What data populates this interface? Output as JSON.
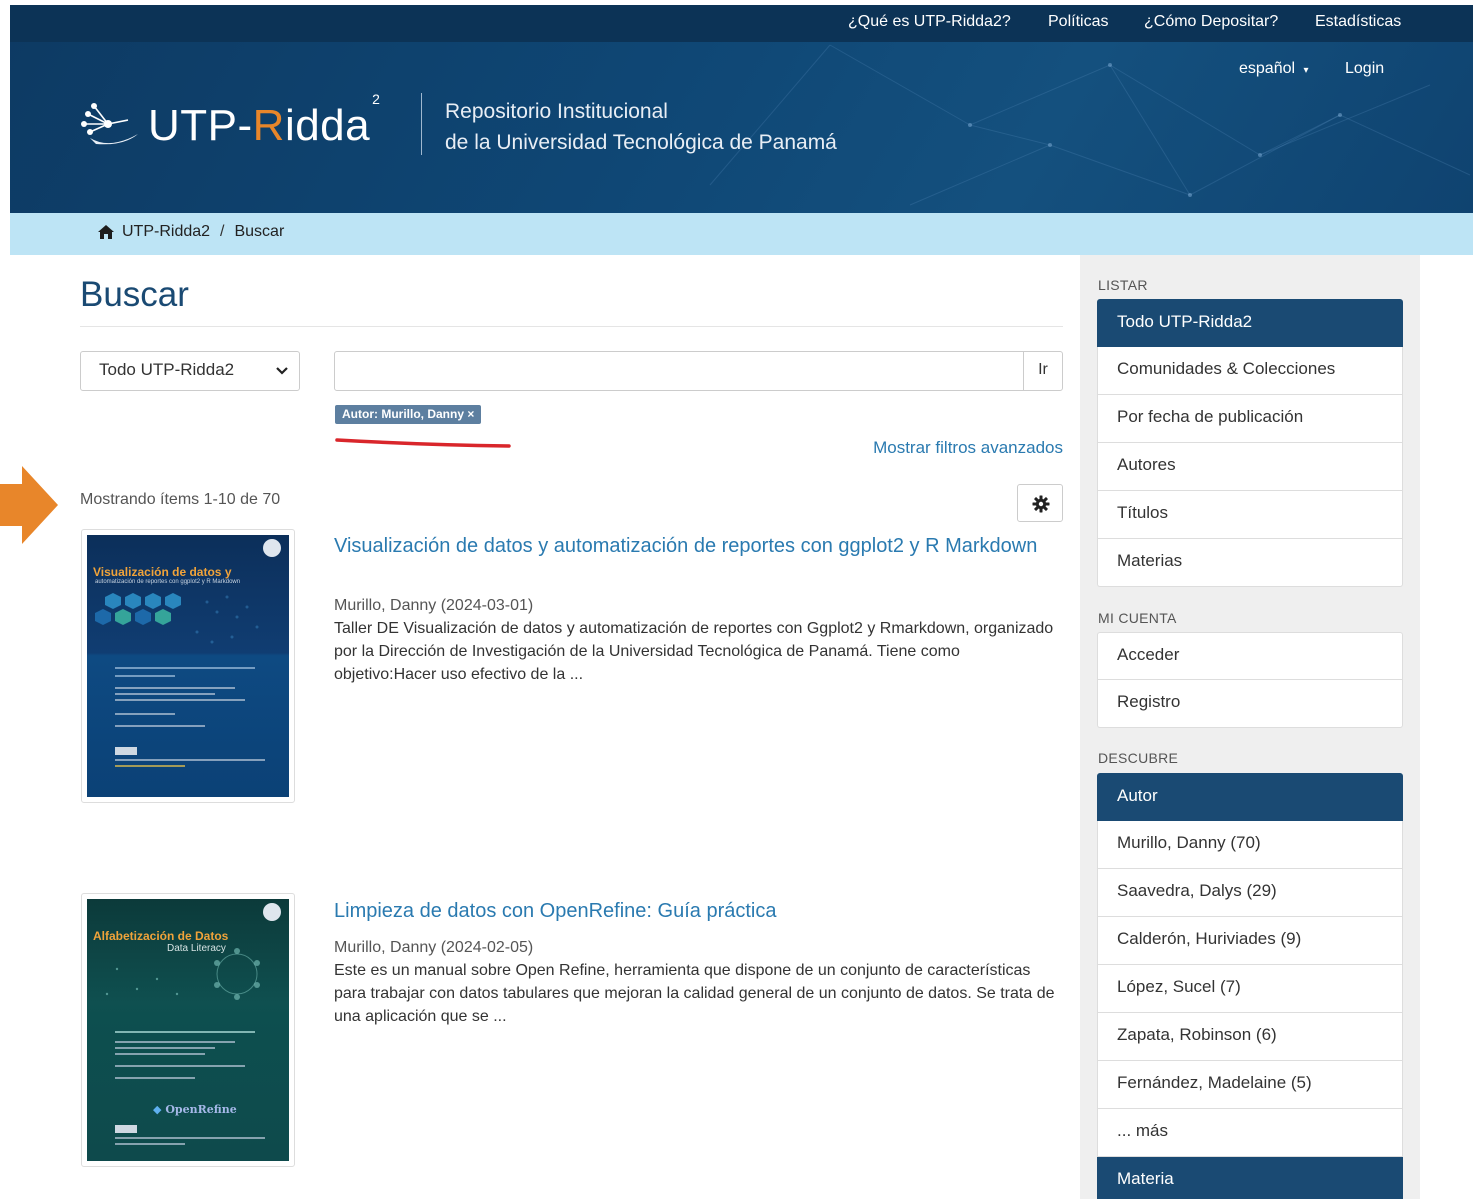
{
  "header": {
    "topnav": [
      "¿Qué es UTP-Ridda2?",
      "Políticas",
      "¿Cómo Depositar?",
      "Estadísticas"
    ],
    "language": "español",
    "login": "Login",
    "logo_prefix": "UTP-",
    "logo_accent": "R",
    "logo_rest": "idda",
    "logo_superscript": "2",
    "repo_line1": "Repositorio Institucional",
    "repo_line2": "de la Universidad Tecnológica de Panamá"
  },
  "breadcrumb": {
    "home": "UTP-Ridda2",
    "separator": "/",
    "current": "Buscar"
  },
  "search": {
    "title": "Buscar",
    "scope_selected": "Todo UTP-Ridda2",
    "query": "",
    "go_label": "Ir",
    "active_filter": "Autor: Murillo, Danny ×",
    "advanced_link": "Mostrar filtros avanzados",
    "showing": "Mostrando ítems 1-10 de 70"
  },
  "results": [
    {
      "title": "Visualización de datos y automatización de reportes con ggplot2 y R Markdown",
      "meta": "Murillo, Danny (2024-03-01)",
      "abstract": "Taller DE Visualización de datos y automatización de reportes con Ggplot2 y Rmarkdown, organizado por la Dirección de Investigación de la Universidad Tecnológica de Panamá. Tiene como objetivo:Hacer uso efectivo de la ...",
      "cover_title": "Visualización de datos y",
      "cover_subtitle": "automatización de reportes con ggplot2 y R Markdown"
    },
    {
      "title": "Limpieza de datos con OpenRefine: Guía práctica",
      "meta": "Murillo, Danny (2024-02-05)",
      "abstract": "Este es un manual sobre Open Refine, herramienta que dispone de un conjunto de características para trabajar con datos tabulares que mejoran la calidad general de un conjunto de datos. Se trata de una aplicación que se ...",
      "cover_title": "Alfabetización de Datos",
      "cover_subtitle": "Data Literacy",
      "cover_brand": "OpenRefine"
    }
  ],
  "sidebar": {
    "listar_heading": "LISTAR",
    "listar": [
      "Todo UTP-Ridda2",
      "Comunidades & Colecciones",
      "Por fecha de publicación",
      "Autores",
      "Títulos",
      "Materias"
    ],
    "cuenta_heading": "MI CUENTA",
    "cuenta": [
      "Acceder",
      "Registro"
    ],
    "descubre_heading": "DESCUBRE",
    "autor_heading": "Autor",
    "autores": [
      "Murillo, Danny (70)",
      "Saavedra, Dalys (29)",
      "Calderón, Huriviades (9)",
      "López, Sucel (7)",
      "Zapata, Robinson (6)",
      "Fernández, Madelaine (5)",
      "... más"
    ],
    "materia_heading": "Materia"
  },
  "colors": {
    "brand_dark": "#1a4a73",
    "link": "#2a7ab0",
    "accent_orange": "#e8862a",
    "breadcrumb_bg": "#bde4f5",
    "annotation_red": "#d9262b"
  }
}
